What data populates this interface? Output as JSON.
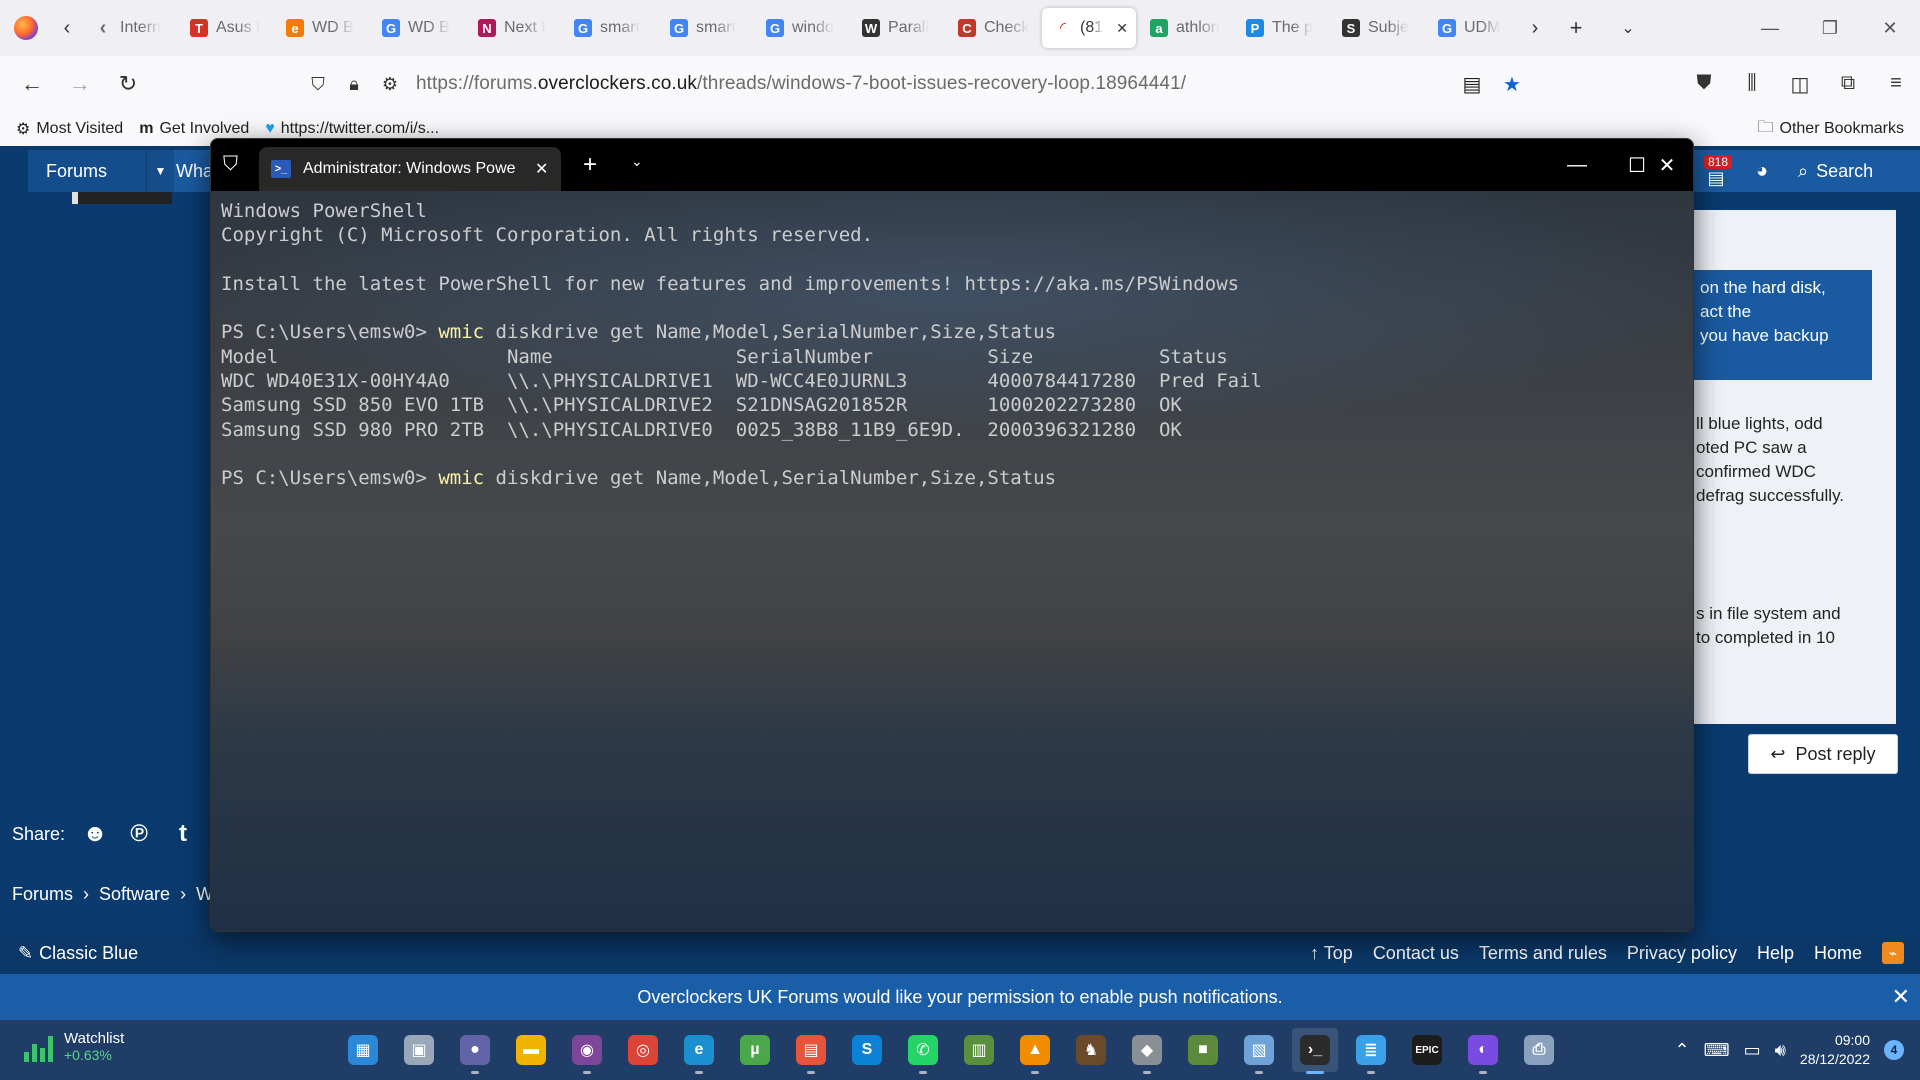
{
  "browser": {
    "tabs": [
      {
        "title": "Intern",
        "icon": "arrow",
        "color": "#6b6b6b"
      },
      {
        "title": "Asus I",
        "icon": "T",
        "color": "#d93025"
      },
      {
        "title": "WD B",
        "icon": "e",
        "color": "#f57c00"
      },
      {
        "title": "WD B",
        "icon": "G",
        "color": "#4285f4"
      },
      {
        "title": "Next I",
        "icon": "N",
        "color": "#b0185a"
      },
      {
        "title": "smart",
        "icon": "G",
        "color": "#4285f4"
      },
      {
        "title": "smart",
        "icon": "G",
        "color": "#4285f4"
      },
      {
        "title": "windo",
        "icon": "G",
        "color": "#4285f4"
      },
      {
        "title": "Parall",
        "icon": "W",
        "color": "#333333"
      },
      {
        "title": "Check",
        "icon": "C",
        "color": "#c0392b"
      },
      {
        "title": "(81",
        "icon": "spinner",
        "color": "#d93025",
        "active": true
      },
      {
        "title": "athlon",
        "icon": "a",
        "color": "#1fa463"
      },
      {
        "title": "The p",
        "icon": "P",
        "color": "#1e88e5"
      },
      {
        "title": "Subje",
        "icon": "S",
        "color": "#333333"
      },
      {
        "title": "UDM",
        "icon": "G",
        "color": "#4285f4"
      }
    ],
    "url_prefix": "https://forums.",
    "url_domain": "overclockers.co.uk",
    "url_path": "/threads/windows-7-boot-issues-recovery-loop.18964441/",
    "bookmarks": [
      {
        "label": "Most Visited",
        "icon": "gear"
      },
      {
        "label": "Get Involved",
        "icon": "m"
      },
      {
        "label": "https://twitter.com/i/s...",
        "icon": "twitter"
      }
    ],
    "other_bookmarks": "Other Bookmarks"
  },
  "forum": {
    "nav_forums": "Forums",
    "nav_what": "What",
    "alerts_count": "818",
    "search_label": "Search",
    "quote_lines": [
      "on the hard disk,",
      "act the",
      "you have backup"
    ],
    "para1": [
      "ll blue lights, odd",
      "oted PC saw a",
      "confirmed WDC",
      "defrag successfully."
    ],
    "para2": [
      "s in file system and",
      "to completed in 10"
    ],
    "post_reply": "Post reply",
    "share_label": "Share:",
    "breadcrumbs": [
      "Forums",
      "Software",
      "W"
    ],
    "style_label": "Classic Blue",
    "footer_links": [
      "Top",
      "Contact us",
      "Terms and rules",
      "Privacy policy",
      "Help",
      "Home"
    ],
    "notice": "Overclockers UK Forums would like your permission to enable push notifications."
  },
  "terminal": {
    "tab_title": "Administrator: Windows Powe",
    "lines": [
      "Windows PowerShell",
      "Copyright (C) Microsoft Corporation. All rights reserved.",
      "",
      "Install the latest PowerShell for new features and improvements! https://aka.ms/PSWindows",
      "",
      "__CMD__",
      "Model                    Name                SerialNumber          Size           Status",
      "WDC WD40E31X-00HY4A0     \\\\.\\PHYSICALDRIVE1  WD-WCC4E0JURNL3       4000784417280  Pred Fail",
      "Samsung SSD 850 EVO 1TB  \\\\.\\PHYSICALDRIVE2  S21DNSAG201852R       1000202273280  OK",
      "Samsung SSD 980 PRO 2TB  \\\\.\\PHYSICALDRIVE0  0025_38B8_11B9_6E9D.  2000396321280  OK",
      "",
      "__CMD__"
    ],
    "prompt": "PS C:\\Users\\emsw0> ",
    "cmd_keyword": "wmic",
    "cmd_args": " diskdrive get Name,Model,SerialNumber,Size,Status"
  },
  "taskbar": {
    "watchlist_title": "Watchlist",
    "watchlist_change": "+0.63%",
    "apps": [
      {
        "name": "start",
        "color": "#2b88d8",
        "glyph": "▦"
      },
      {
        "name": "task-view",
        "color": "#9aa7b8",
        "glyph": "▣"
      },
      {
        "name": "teams-chat",
        "color": "#6264a7",
        "glyph": "●"
      },
      {
        "name": "file-explorer",
        "color": "#f0b400",
        "glyph": "▬"
      },
      {
        "name": "tor",
        "color": "#7d4698",
        "glyph": "◉"
      },
      {
        "name": "chrome",
        "color": "#db4437",
        "glyph": "◎"
      },
      {
        "name": "edge",
        "color": "#1b8fd0",
        "glyph": "e"
      },
      {
        "name": "utorrent",
        "color": "#4aa84a",
        "glyph": "µ"
      },
      {
        "name": "store",
        "color": "#e5553b",
        "glyph": "▤"
      },
      {
        "name": "skype",
        "color": "#0b82d6",
        "glyph": "S"
      },
      {
        "name": "whatsapp",
        "color": "#25d366",
        "glyph": "✆"
      },
      {
        "name": "gpu-z",
        "color": "#5a8f3c",
        "glyph": "▥"
      },
      {
        "name": "vlc",
        "color": "#f28c00",
        "glyph": "▲"
      },
      {
        "name": "game",
        "color": "#6b4a2a",
        "glyph": "♞"
      },
      {
        "name": "disk-tool",
        "color": "#8a8f96",
        "glyph": "◆"
      },
      {
        "name": "minecraft",
        "color": "#5d8a3a",
        "glyph": "■"
      },
      {
        "name": "monitor",
        "color": "#6fa3d8",
        "glyph": "▧"
      },
      {
        "name": "terminal",
        "color": "#2b2b2b",
        "glyph": "›_",
        "active": true
      },
      {
        "name": "notepad",
        "color": "#3aa0e8",
        "glyph": "≣"
      },
      {
        "name": "epic-games",
        "color": "#1d1d1d",
        "glyph": "EPIC"
      },
      {
        "name": "firefox",
        "color": "#7a4be0",
        "glyph": "◐"
      },
      {
        "name": "printer",
        "color": "#8aa0bc",
        "glyph": "⎙"
      }
    ],
    "time": "09:00",
    "date": "28/12/2022",
    "notification_count": "4"
  }
}
